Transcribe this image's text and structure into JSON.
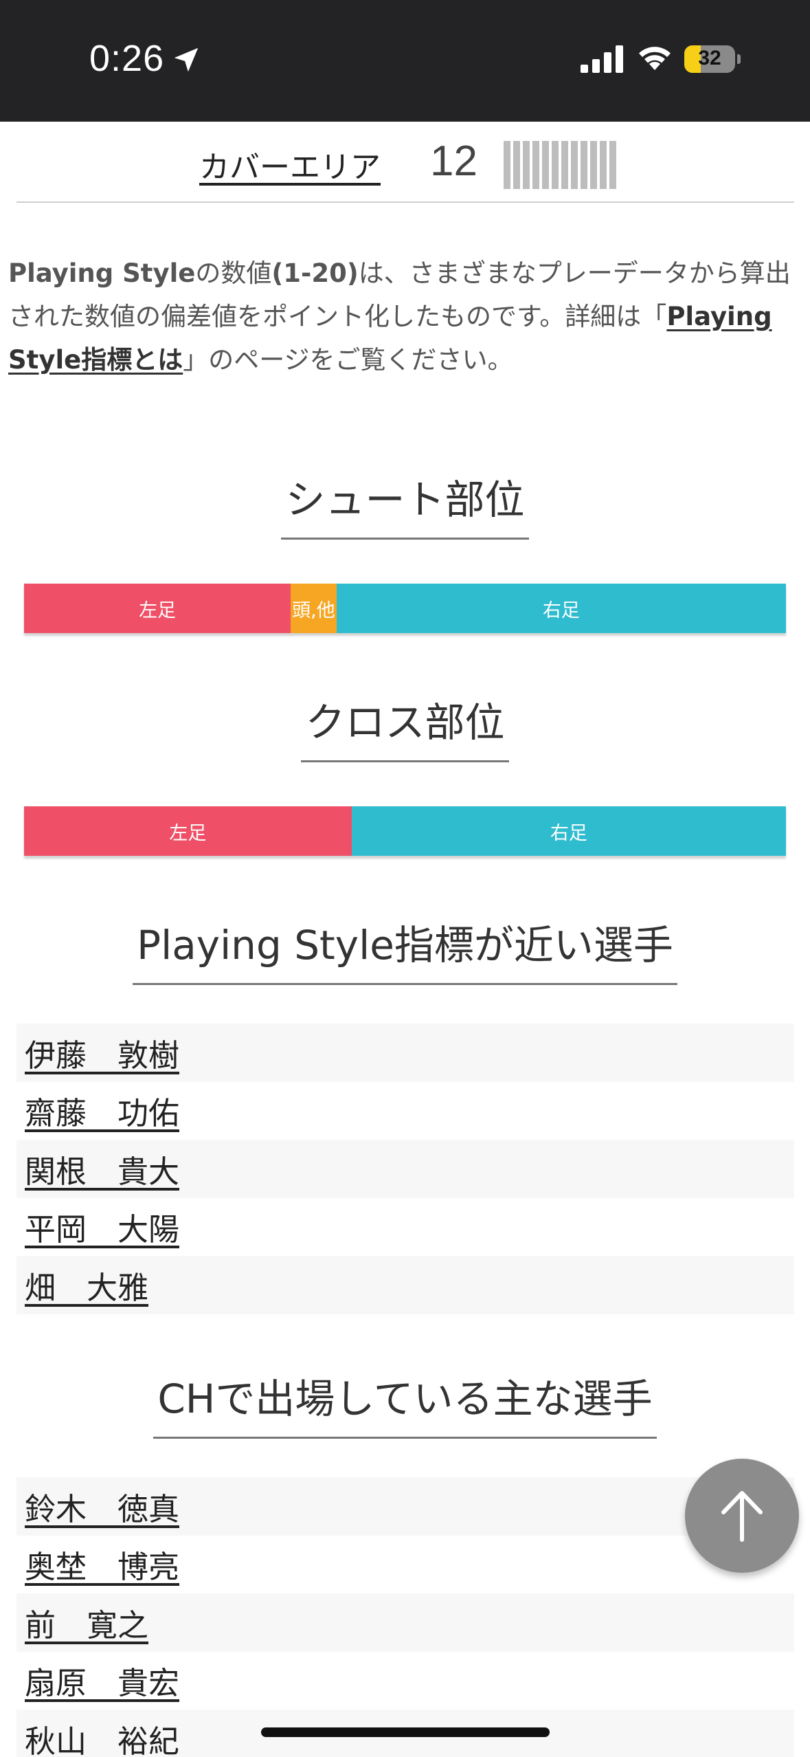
{
  "status_bar": {
    "time": "0:26",
    "battery_level": "32",
    "battery_fraction": 0.32,
    "icons": [
      "location-arrow-icon",
      "cellular-signal-icon",
      "wifi-icon",
      "battery-icon"
    ]
  },
  "cover_area": {
    "label": "カバーエリア",
    "value": "12",
    "bar_count": 12
  },
  "note": {
    "part1_bold": "Playing Style",
    "part2": "の数値",
    "part3_bold": "(1-20)",
    "part4": "は、さまざまなプレーデータから算出された数値の偏差値をポイント化したものです。詳細は「",
    "link": "Playing Style指標とは",
    "part5": "」のページをご覧ください。"
  },
  "shoot_section": {
    "title": "シュート部位",
    "segments": [
      {
        "label": "左足",
        "share": 0.35,
        "color": "#ef5067"
      },
      {
        "label": "頭,他",
        "share": 0.06,
        "color": "#f6a623"
      },
      {
        "label": "右足",
        "share": 0.59,
        "color": "#2fbccf"
      }
    ]
  },
  "cross_section": {
    "title": "クロス部位",
    "segments": [
      {
        "label": "左足",
        "share": 0.43,
        "color": "#ef5067"
      },
      {
        "label": "右足",
        "share": 0.57,
        "color": "#2fbccf"
      }
    ]
  },
  "similar_section": {
    "title": "Playing Style指標が近い選手",
    "players": [
      "伊藤　敦樹",
      "齋藤　功佑",
      "関根　貴大",
      "平岡　大陽",
      "畑　大雅"
    ]
  },
  "ch_section": {
    "title": "CHで出場している主な選手",
    "players": [
      "鈴木　徳真",
      "奥埜　博亮",
      "前　寛之",
      "扇原　貴宏",
      "秋山　裕紀"
    ]
  },
  "fab": {
    "icon": "arrow-up-icon"
  }
}
